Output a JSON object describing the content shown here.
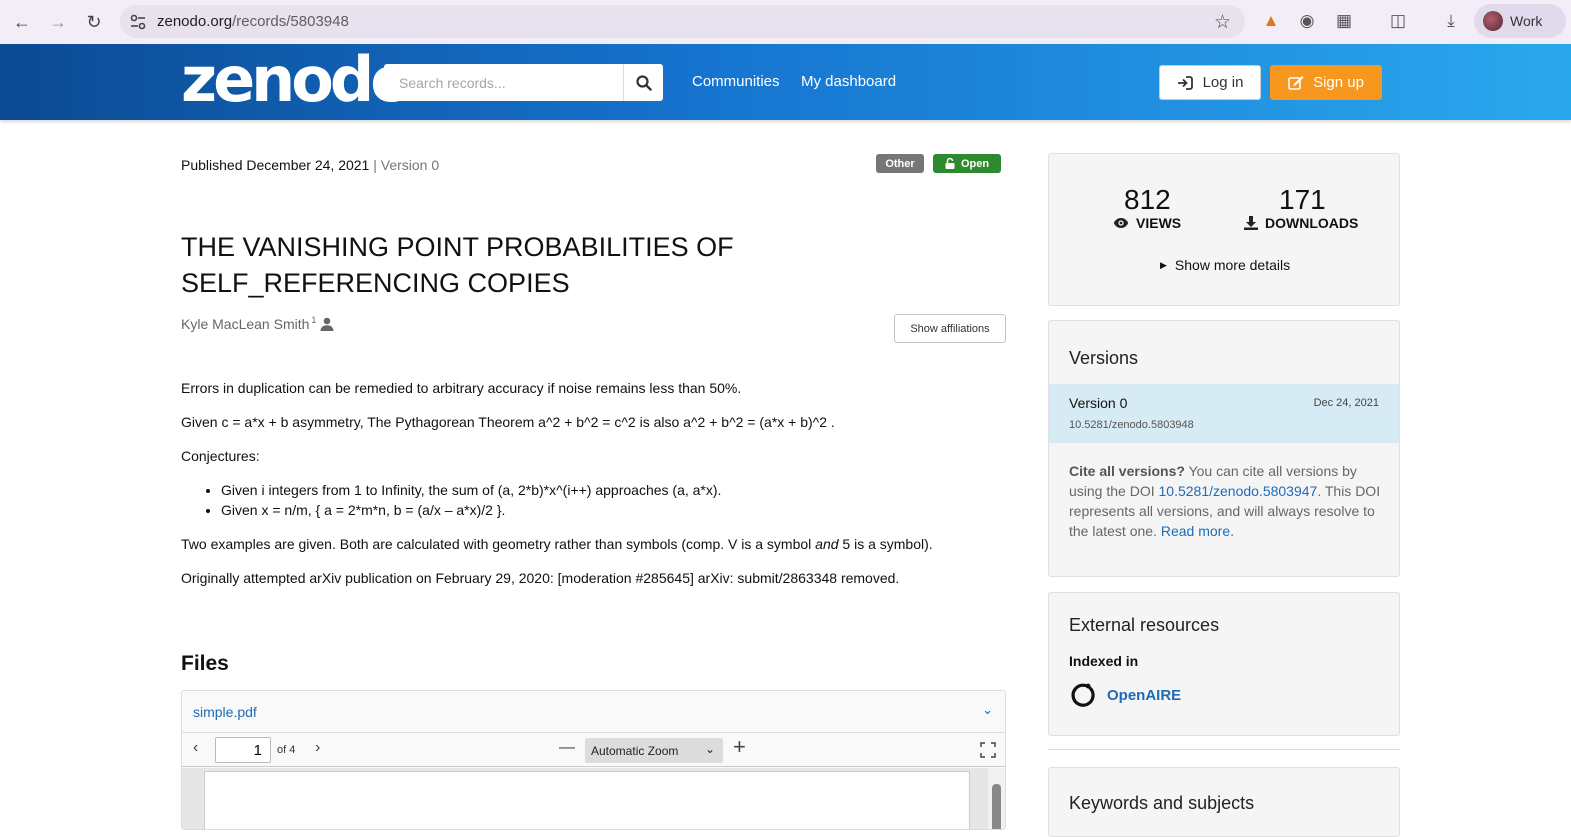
{
  "browser": {
    "url_host": "zenodo.org",
    "url_path": "/records/5803948",
    "profile_label": "Work"
  },
  "header": {
    "logo": "zenodo",
    "search_placeholder": "Search records...",
    "nav": [
      "Communities",
      "My dashboard"
    ],
    "login": "Log in",
    "signup": "Sign up"
  },
  "record": {
    "published": "Published December 24, 2021",
    "version": "| Version 0",
    "badge_type": "Other",
    "badge_access": "Open",
    "title": "THE VANISHING POINT PROBABILITIES OF SELF_REFERENCING COPIES",
    "author": "Kyle MacLean Smith",
    "author_sup": "1",
    "affiliations_button": "Show affiliations",
    "description": {
      "p1": "Errors in duplication can be remedied to arbitrary accuracy if noise remains less than 50%.",
      "p2": "Given c = a*x + b asymmetry, The Pythagorean Theorem a^2 + b^2 = c^2 is also a^2 + b^2 = (a*x + b)^2 .",
      "p3": "Conjectures:",
      "bullets": [
        "Given i integers from 1 to Infinity, the sum of (a, 2*b)*x^(i++) approaches (a, a*x).",
        "Given x = n/m, { a = 2*m*n, b = (a/x – a*x)/2 }."
      ],
      "p4_pre": "Two examples are given. Both are calculated with geometry rather than symbols (comp. V is a symbol ",
      "p4_em": "and",
      "p4_post": " 5 is a symbol).",
      "p5": "Originally attempted arXiv publication on February 29, 2020: [moderation #285645] arXiv: submit/2863348 removed."
    }
  },
  "files": {
    "heading": "Files",
    "filename": "simple.pdf",
    "page": "1",
    "of_pages": "of 4",
    "zoom": "Automatic Zoom"
  },
  "stats": {
    "views": "812",
    "views_label": "VIEWS",
    "downloads": "171",
    "downloads_label": "DOWNLOADS",
    "show_more": "Show more details"
  },
  "versions": {
    "heading": "Versions",
    "item_name": "Version 0",
    "item_date": "Dec 24, 2021",
    "item_doi": "10.5281/zenodo.5803948",
    "cite_bold": "Cite all versions?",
    "cite_text1": " You can cite all versions by using the DOI ",
    "cite_doi": "10.5281/zenodo.5803947",
    "cite_text2": ". This DOI represents all versions, and will always resolve to the latest one. ",
    "read_more": "Read more."
  },
  "external": {
    "heading": "External resources",
    "indexed_in": "Indexed in",
    "source": "OpenAIRE"
  },
  "keywords": {
    "heading": "Keywords and subjects"
  }
}
